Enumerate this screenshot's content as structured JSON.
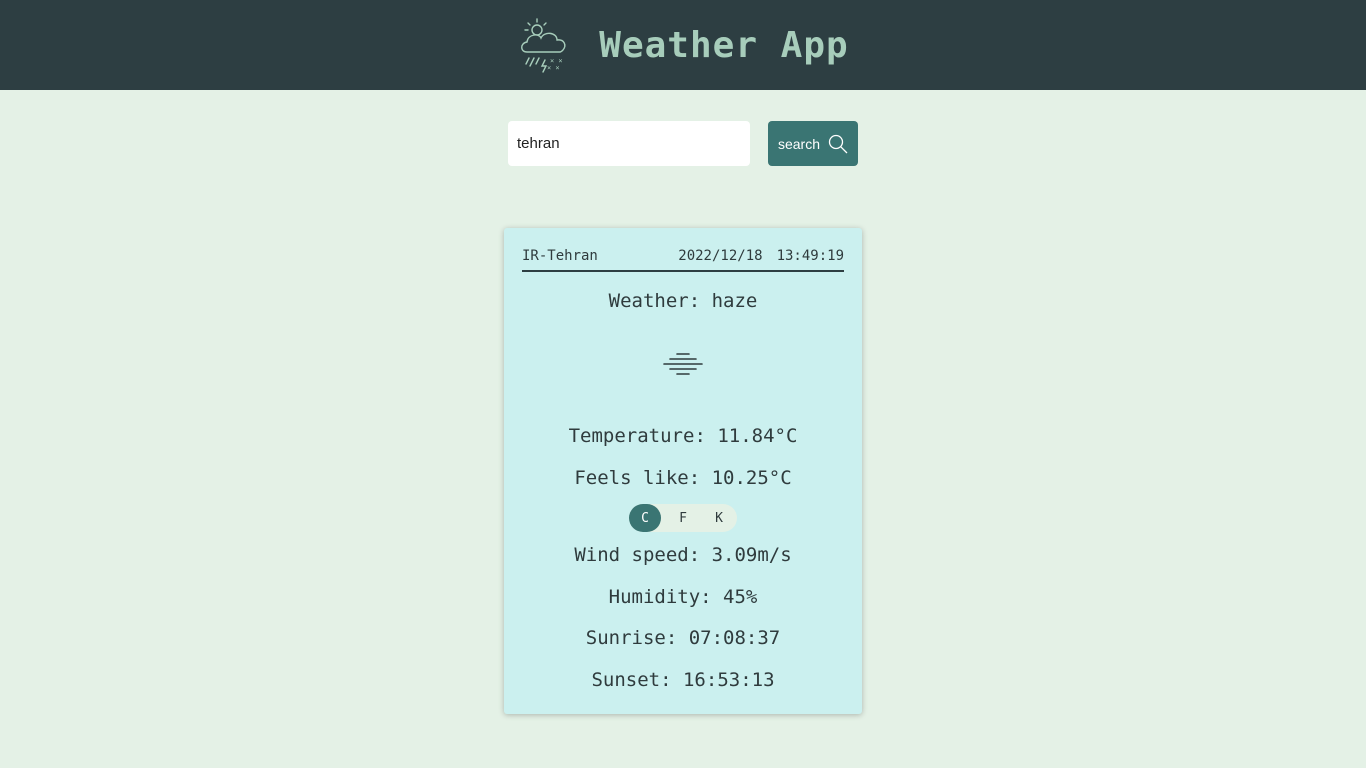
{
  "app": {
    "title": "Weather App"
  },
  "search": {
    "value": "tehran",
    "button_label": "search"
  },
  "card": {
    "location": "IR-Tehran",
    "date": "2022/12/18",
    "time": "13:49:19",
    "weather": "Weather: haze",
    "weather_icon": "haze-icon",
    "temperature": "Temperature: 11.84°C",
    "feels_like": "Feels like: 10.25°C",
    "units": {
      "c": "C",
      "f": "F",
      "k": "K",
      "selected": "C"
    },
    "wind": "Wind speed: 3.09m/s",
    "humidity": "Humidity: 45%",
    "sunrise": "Sunrise: 07:08:37",
    "sunset": "Sunset: 16:53:13"
  },
  "colors": {
    "header_bg": "#2d3e42",
    "title": "#a7cdbb",
    "page_bg": "#e4f1e6",
    "card_bg": "#cbf0ef",
    "accent": "#3a7573"
  }
}
